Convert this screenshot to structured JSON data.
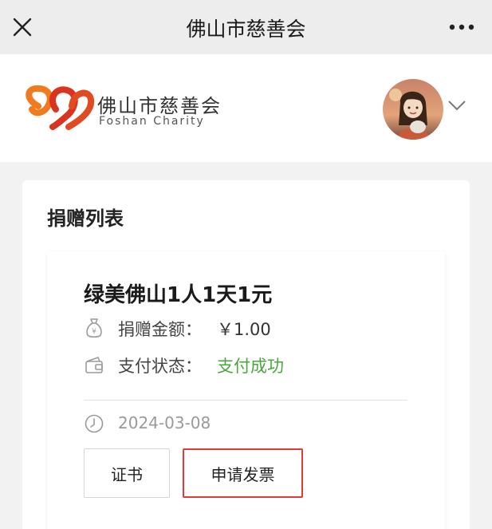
{
  "navbar": {
    "title": "佛山市慈善会",
    "close_icon": "close-icon",
    "more_icon": "more-dots-icon"
  },
  "header": {
    "logo_cn": "佛山市慈善会",
    "logo_en": "Foshan Charity",
    "avatar_icon": "user-avatar",
    "dropdown_icon": "chevron-down-icon"
  },
  "donations": {
    "title": "捐赠列表",
    "items": [
      {
        "project_name": "绿美佛山1人1天1元",
        "amount_label": "捐赠金额：",
        "amount_value": "￥1.00",
        "status_label": "支付状态：",
        "status_value": "支付成功",
        "date": "2024-03-08",
        "certificate_button": "证书",
        "invoice_button": "申请发票"
      }
    ]
  },
  "colors": {
    "status_success": "#4aa63c",
    "highlight_border": "#e53935",
    "logo_red": "#d9341f",
    "logo_orange": "#f07a1d"
  }
}
